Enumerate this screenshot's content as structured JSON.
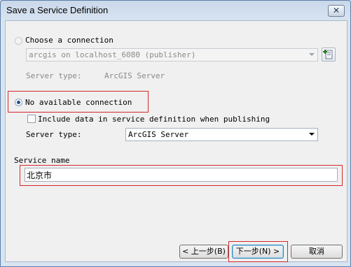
{
  "dialog": {
    "title": "Save a Service Definition",
    "close_symbol": "✕"
  },
  "choose_connection": {
    "label": "Choose a connection",
    "selected": false,
    "connection_value": "arcgis on localhost_6080 (publisher)",
    "server_type_label": "Server type:",
    "server_type_value": "ArcGIS Server"
  },
  "no_connection": {
    "label": "No available connection",
    "selected": true,
    "include_data_label": "Include data in service definition when publishing",
    "include_data_checked": false,
    "server_type_label": "Server type:",
    "server_type_value": "ArcGIS Server"
  },
  "service_name": {
    "label": "Service name",
    "value": "北京市"
  },
  "buttons": {
    "back": "< 上一步(B)",
    "next": "下一步(N) >",
    "cancel": "取消"
  }
}
